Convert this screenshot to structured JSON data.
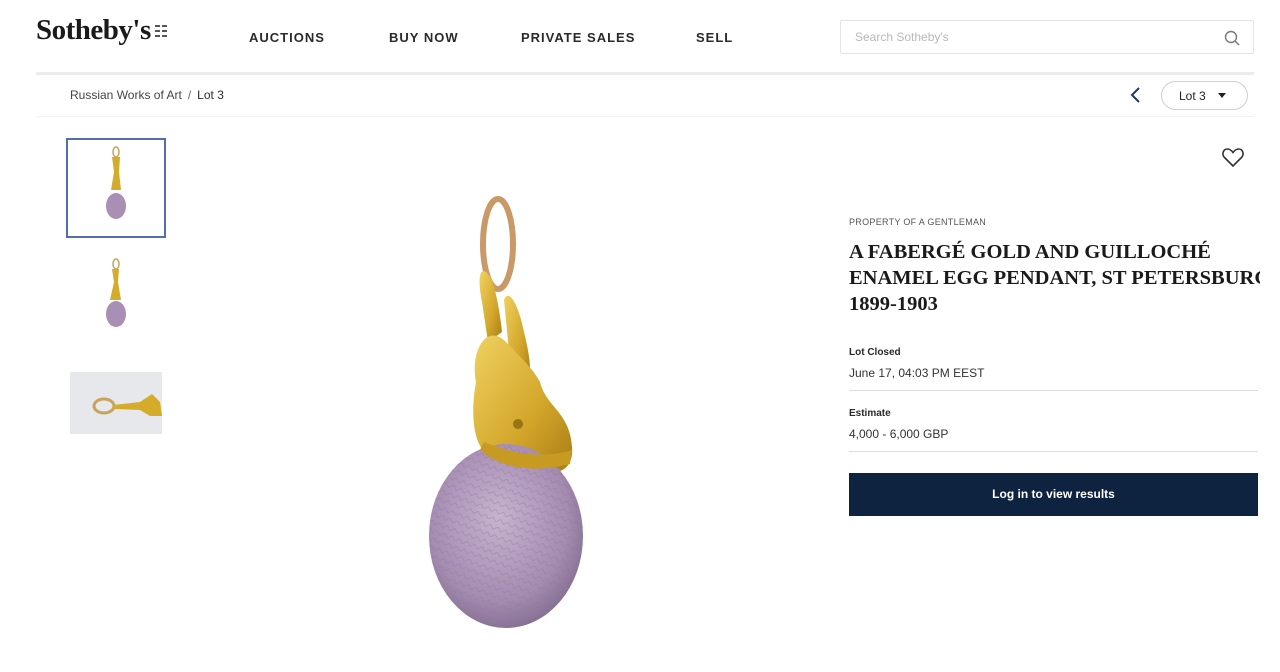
{
  "header": {
    "logo": "Sotheby's",
    "nav": [
      "AUCTIONS",
      "BUY NOW",
      "PRIVATE SALES",
      "SELL"
    ],
    "search_placeholder": "Search Sotheby's"
  },
  "breadcrumb": {
    "parent": "Russian Works of Art",
    "separator": "/",
    "current": "Lot 3"
  },
  "lot_selector": {
    "label": "Lot 3"
  },
  "thumbnails": {
    "count": 3,
    "selected_index": 0
  },
  "lot": {
    "eyebrow": "PROPERTY OF A GENTLEMAN",
    "title_line1": "A FABERGÉ GOLD AND GUILLOCHÉ",
    "title_line2": "ENAMEL EGG PENDANT, ST PETERSBURG,",
    "title_line3": "1899-1903",
    "closed_label": "Lot Closed",
    "closed_value": "June 17, 04:03 PM EEST",
    "estimate_label": "Estimate",
    "estimate_value": "4,000 - 6,000 GBP",
    "cta": "Log in to view results"
  },
  "colors": {
    "cta_background": "#0d2340",
    "selected_thumb_border": "#4f6fa8",
    "enamel": "#a98fb3",
    "gold": "#d4ac2a"
  },
  "icons": [
    "search-icon",
    "chevron-left-icon",
    "caret-down-icon",
    "heart-icon"
  ]
}
